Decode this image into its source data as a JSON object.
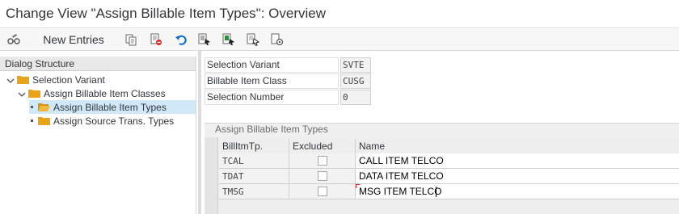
{
  "window": {
    "title": "Change View \"Assign Billable Item Types\": Overview"
  },
  "toolbar": {
    "new_entries_label": "New Entries",
    "icons": [
      "glasses-edit-icon",
      "copy-icon",
      "delete-icon",
      "undo-icon",
      "select-all-icon",
      "select-block-icon",
      "deselect-all-icon",
      "configure-icon"
    ]
  },
  "dialog_structure": {
    "header": "Dialog Structure",
    "nodes": [
      {
        "label": "Selection Variant",
        "level": 0,
        "expanded": true
      },
      {
        "label": "Assign Billable Item Classes",
        "level": 1,
        "expanded": true
      },
      {
        "label": "Assign Billable Item Types",
        "level": 2,
        "selected": true
      },
      {
        "label": "Assign Source Trans. Types",
        "level": 2,
        "selected": false
      }
    ]
  },
  "selection": {
    "fields": [
      {
        "label": "Selection Variant",
        "value": "SVTE"
      },
      {
        "label": "Billable Item Class",
        "value": "CUSG"
      },
      {
        "label": "Selection Number",
        "value": "0"
      }
    ]
  },
  "table": {
    "title": "Assign Billable Item Types",
    "columns": [
      "BillItmTp.",
      "Excluded",
      "Name"
    ],
    "rows": [
      {
        "type": "TCAL",
        "excluded": false,
        "name": "CALL ITEM TELCO"
      },
      {
        "type": "TDAT",
        "excluded": false,
        "name": "DATA ITEM TELCO"
      },
      {
        "type": "TMSG",
        "excluded": false,
        "name": "MSG ITEM TELCO"
      }
    ]
  },
  "colors": {
    "selected_node": "#d1e8f8",
    "folder": "#e8a317",
    "accent_blue": "#0a6ed1",
    "error_red": "#e02020"
  }
}
